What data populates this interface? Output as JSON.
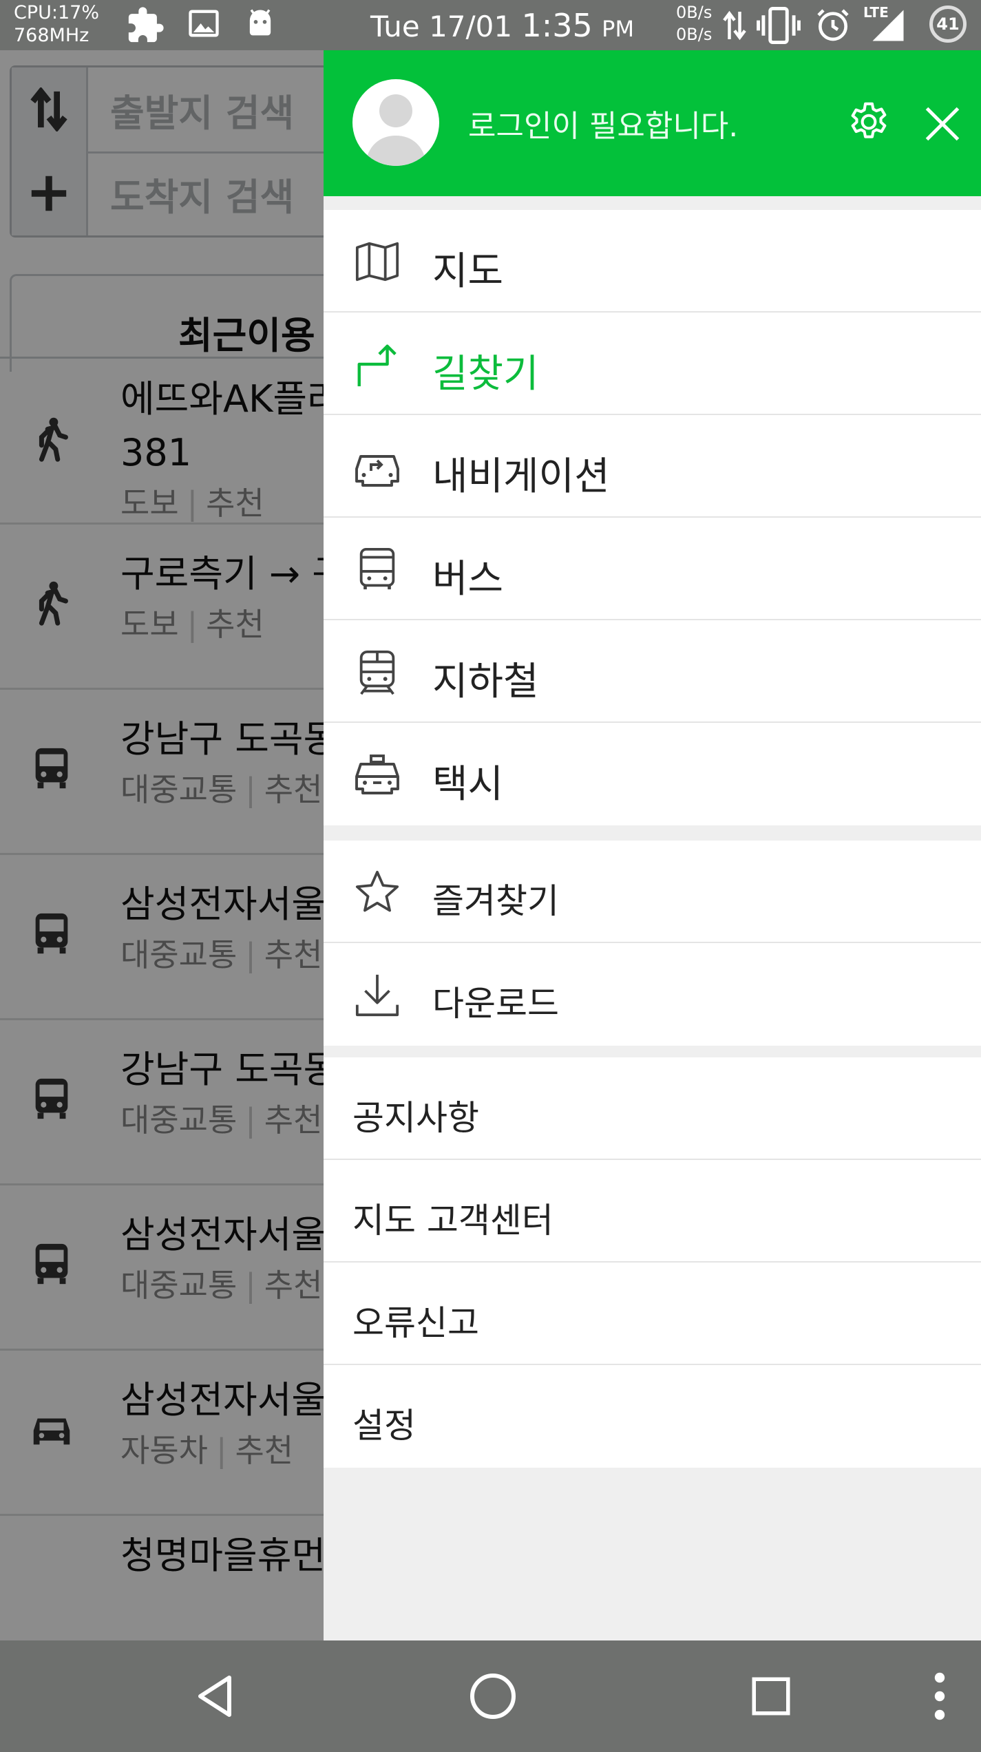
{
  "status_bar": {
    "cpu": "CPU:17%",
    "freq": "768MHz",
    "date": "Tue 17/01",
    "time": "1:35",
    "ampm": "PM",
    "net_up": "0B/s",
    "net_down": "0B/s",
    "network": "LTE",
    "battery": "41"
  },
  "background": {
    "origin_placeholder": "출발지 검색",
    "destination_placeholder": "도착지 검색",
    "tab_recent": "최근이용",
    "items": [
      {
        "icon": "walk-icon",
        "title": "에뜨와AK플라",
        "title2": "381",
        "mode": "도보",
        "option": "추천"
      },
      {
        "icon": "walk-icon",
        "title": "구로측기 → 구",
        "mode": "도보",
        "option": "추천"
      },
      {
        "icon": "bus-icon",
        "title": "강남구 도곡동",
        "mode": "대중교통",
        "option": "추천"
      },
      {
        "icon": "bus-icon",
        "title": "삼성전자서울",
        "mode": "대중교통",
        "option": "추천"
      },
      {
        "icon": "bus-icon",
        "title": "강남구 도곡동",
        "mode": "대중교통",
        "option": "추천"
      },
      {
        "icon": "bus-icon",
        "title": "삼성전자서울",
        "mode": "대중교통",
        "option": "추천"
      },
      {
        "icon": "car-icon",
        "title": "삼성전자서울",
        "mode": "자동차",
        "option": "추천"
      },
      {
        "icon": "none",
        "title": "청명마을휴먼"
      }
    ]
  },
  "drawer": {
    "login_text": "로그인이 필요합니다.",
    "accent_color": "#03c13a",
    "main_items": [
      {
        "label": "지도",
        "icon": "map-icon"
      },
      {
        "label": "길찾기",
        "icon": "directions-icon",
        "active": true
      },
      {
        "label": "내비게이션",
        "icon": "navigation-car-icon"
      },
      {
        "label": "버스",
        "icon": "bus-icon"
      },
      {
        "label": "지하철",
        "icon": "subway-icon"
      },
      {
        "label": "택시",
        "icon": "taxi-icon"
      }
    ],
    "secondary_items": [
      {
        "label": "즐겨찾기",
        "icon": "star-icon"
      },
      {
        "label": "다운로드",
        "icon": "download-icon"
      }
    ],
    "text_items": [
      {
        "label": "공지사항"
      },
      {
        "label": "지도 고객센터"
      },
      {
        "label": "오류신고"
      },
      {
        "label": "설정"
      }
    ]
  }
}
